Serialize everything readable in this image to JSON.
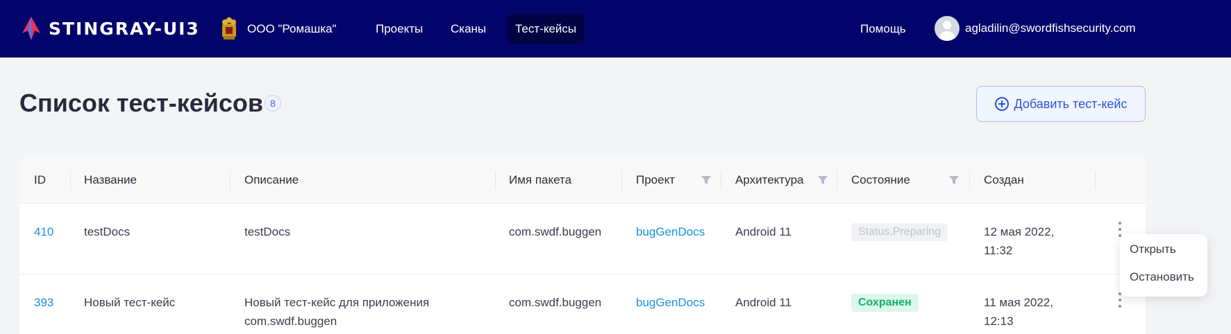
{
  "header": {
    "logo_text": "STINGRAY-UI3",
    "organization": "ООО \"Ромашка\"",
    "nav": [
      {
        "label": "Проекты"
      },
      {
        "label": "Сканы"
      },
      {
        "label": "Тест-кейсы"
      }
    ],
    "help_label": "Помощь",
    "user_email": "agladilin@swordfishsecurity.com"
  },
  "page": {
    "title": "Список тест-кейсов",
    "count": "8",
    "add_button_label": "Добавить тест-кейс"
  },
  "table": {
    "columns": [
      "ID",
      "Название",
      "Описание",
      "Имя пакета",
      "Проект",
      "Архитектура",
      "Состояние",
      "Создан"
    ],
    "rows": [
      {
        "id": "410",
        "name": "testDocs",
        "description": "testDocs",
        "package": "com.swdf.buggen",
        "project": "bugGenDocs",
        "architecture": "Android 11",
        "status": "Status.Preparing",
        "created": "12 мая 2022,\n11:32"
      },
      {
        "id": "393",
        "name": "Новый тест-кейс",
        "description": "Новый тест-кейс для приложения\ncom.swdf.buggen",
        "package": "com.swdf.buggen",
        "project": "bugGenDocs",
        "architecture": "Android 11",
        "status": "Сохранен",
        "created": "11 мая 2022,\n12:13"
      }
    ]
  },
  "context_menu": {
    "items": [
      {
        "label": "Открыть"
      },
      {
        "label": "Остановить"
      }
    ]
  },
  "colors": {
    "header_bg": "#03046b",
    "active_nav_bg": "#010344",
    "link": "#1890e0",
    "accent": "#2956d8",
    "status_saved": "#14b267"
  }
}
